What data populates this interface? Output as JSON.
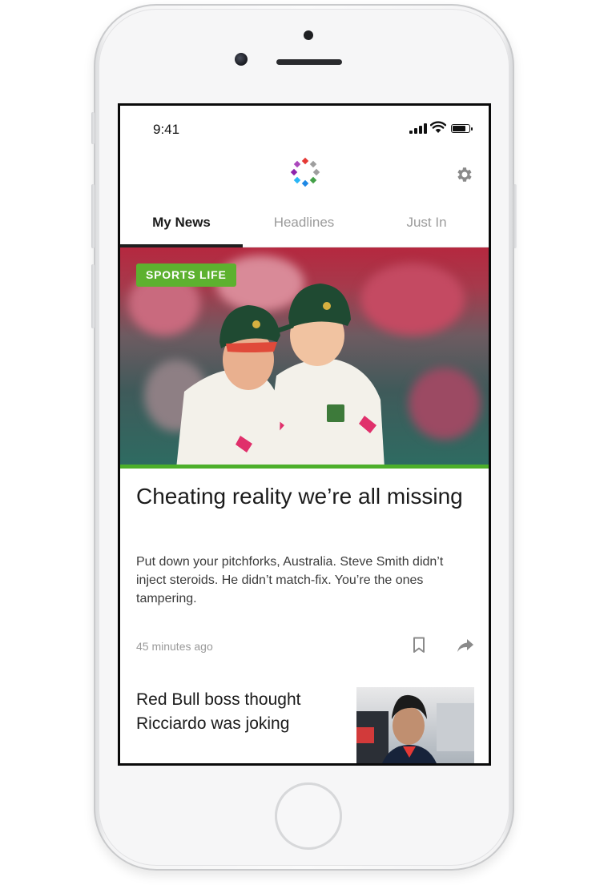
{
  "status_bar": {
    "time": "9:41",
    "battery_level": 0.85
  },
  "header": {
    "logo_icon": "colorful-dots-logo-icon",
    "settings_icon": "gear-icon"
  },
  "tabs": [
    {
      "label": "My News",
      "active": true
    },
    {
      "label": "Headlines",
      "active": false
    },
    {
      "label": "Just In",
      "active": false
    }
  ],
  "feature_story": {
    "tag": "SPORTS LIFE",
    "tag_color": "#5db12f",
    "headline": "Cheating reality we’re all missing",
    "summary": "Put down your pitchforks, Australia. Steve Smith didn’t inject steroids. He didn’t match-fix. You’re the ones tampering.",
    "time_ago": "45 minutes ago",
    "accent_color": "#4caf2a"
  },
  "story_2": {
    "title": "Red Bull boss thought Ricciardo was joking"
  }
}
